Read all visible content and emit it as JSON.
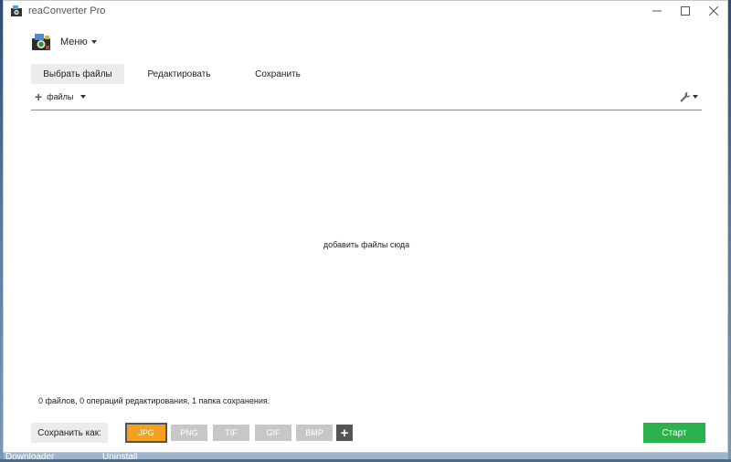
{
  "window": {
    "title": "reaConverter Pro",
    "controls": [
      "minimize-icon",
      "maximize-icon",
      "close-icon"
    ]
  },
  "menu": {
    "label": "Меню"
  },
  "tabs": [
    {
      "label": "Выбрать файлы",
      "active": true
    },
    {
      "label": "Редактировать",
      "active": false
    },
    {
      "label": "Сохранить",
      "active": false
    }
  ],
  "toolbar": {
    "add_files_label": "файлы",
    "tools_icon": "wrench-icon"
  },
  "dropzone": {
    "hint": "добавить файлы сюда"
  },
  "status": {
    "text": "0 файлов, 0 операций редактирования, 1 папка сохранения."
  },
  "bottom": {
    "save_as_label": "Сохранить как:",
    "formats": [
      {
        "label": "JPG",
        "active": true
      },
      {
        "label": "PNG",
        "active": false
      },
      {
        "label": "TIF",
        "active": false
      },
      {
        "label": "GIF",
        "active": false
      },
      {
        "label": "BMP",
        "active": false
      }
    ],
    "add_format_label": "+",
    "start_label": "Старт"
  },
  "desktop": {
    "taskbar_left": "Downloader",
    "taskbar_mid": "Uninstall"
  },
  "colors": {
    "active_format": "#f4a120",
    "start_button": "#2bb24c",
    "tab_active_bg": "#ececec"
  }
}
